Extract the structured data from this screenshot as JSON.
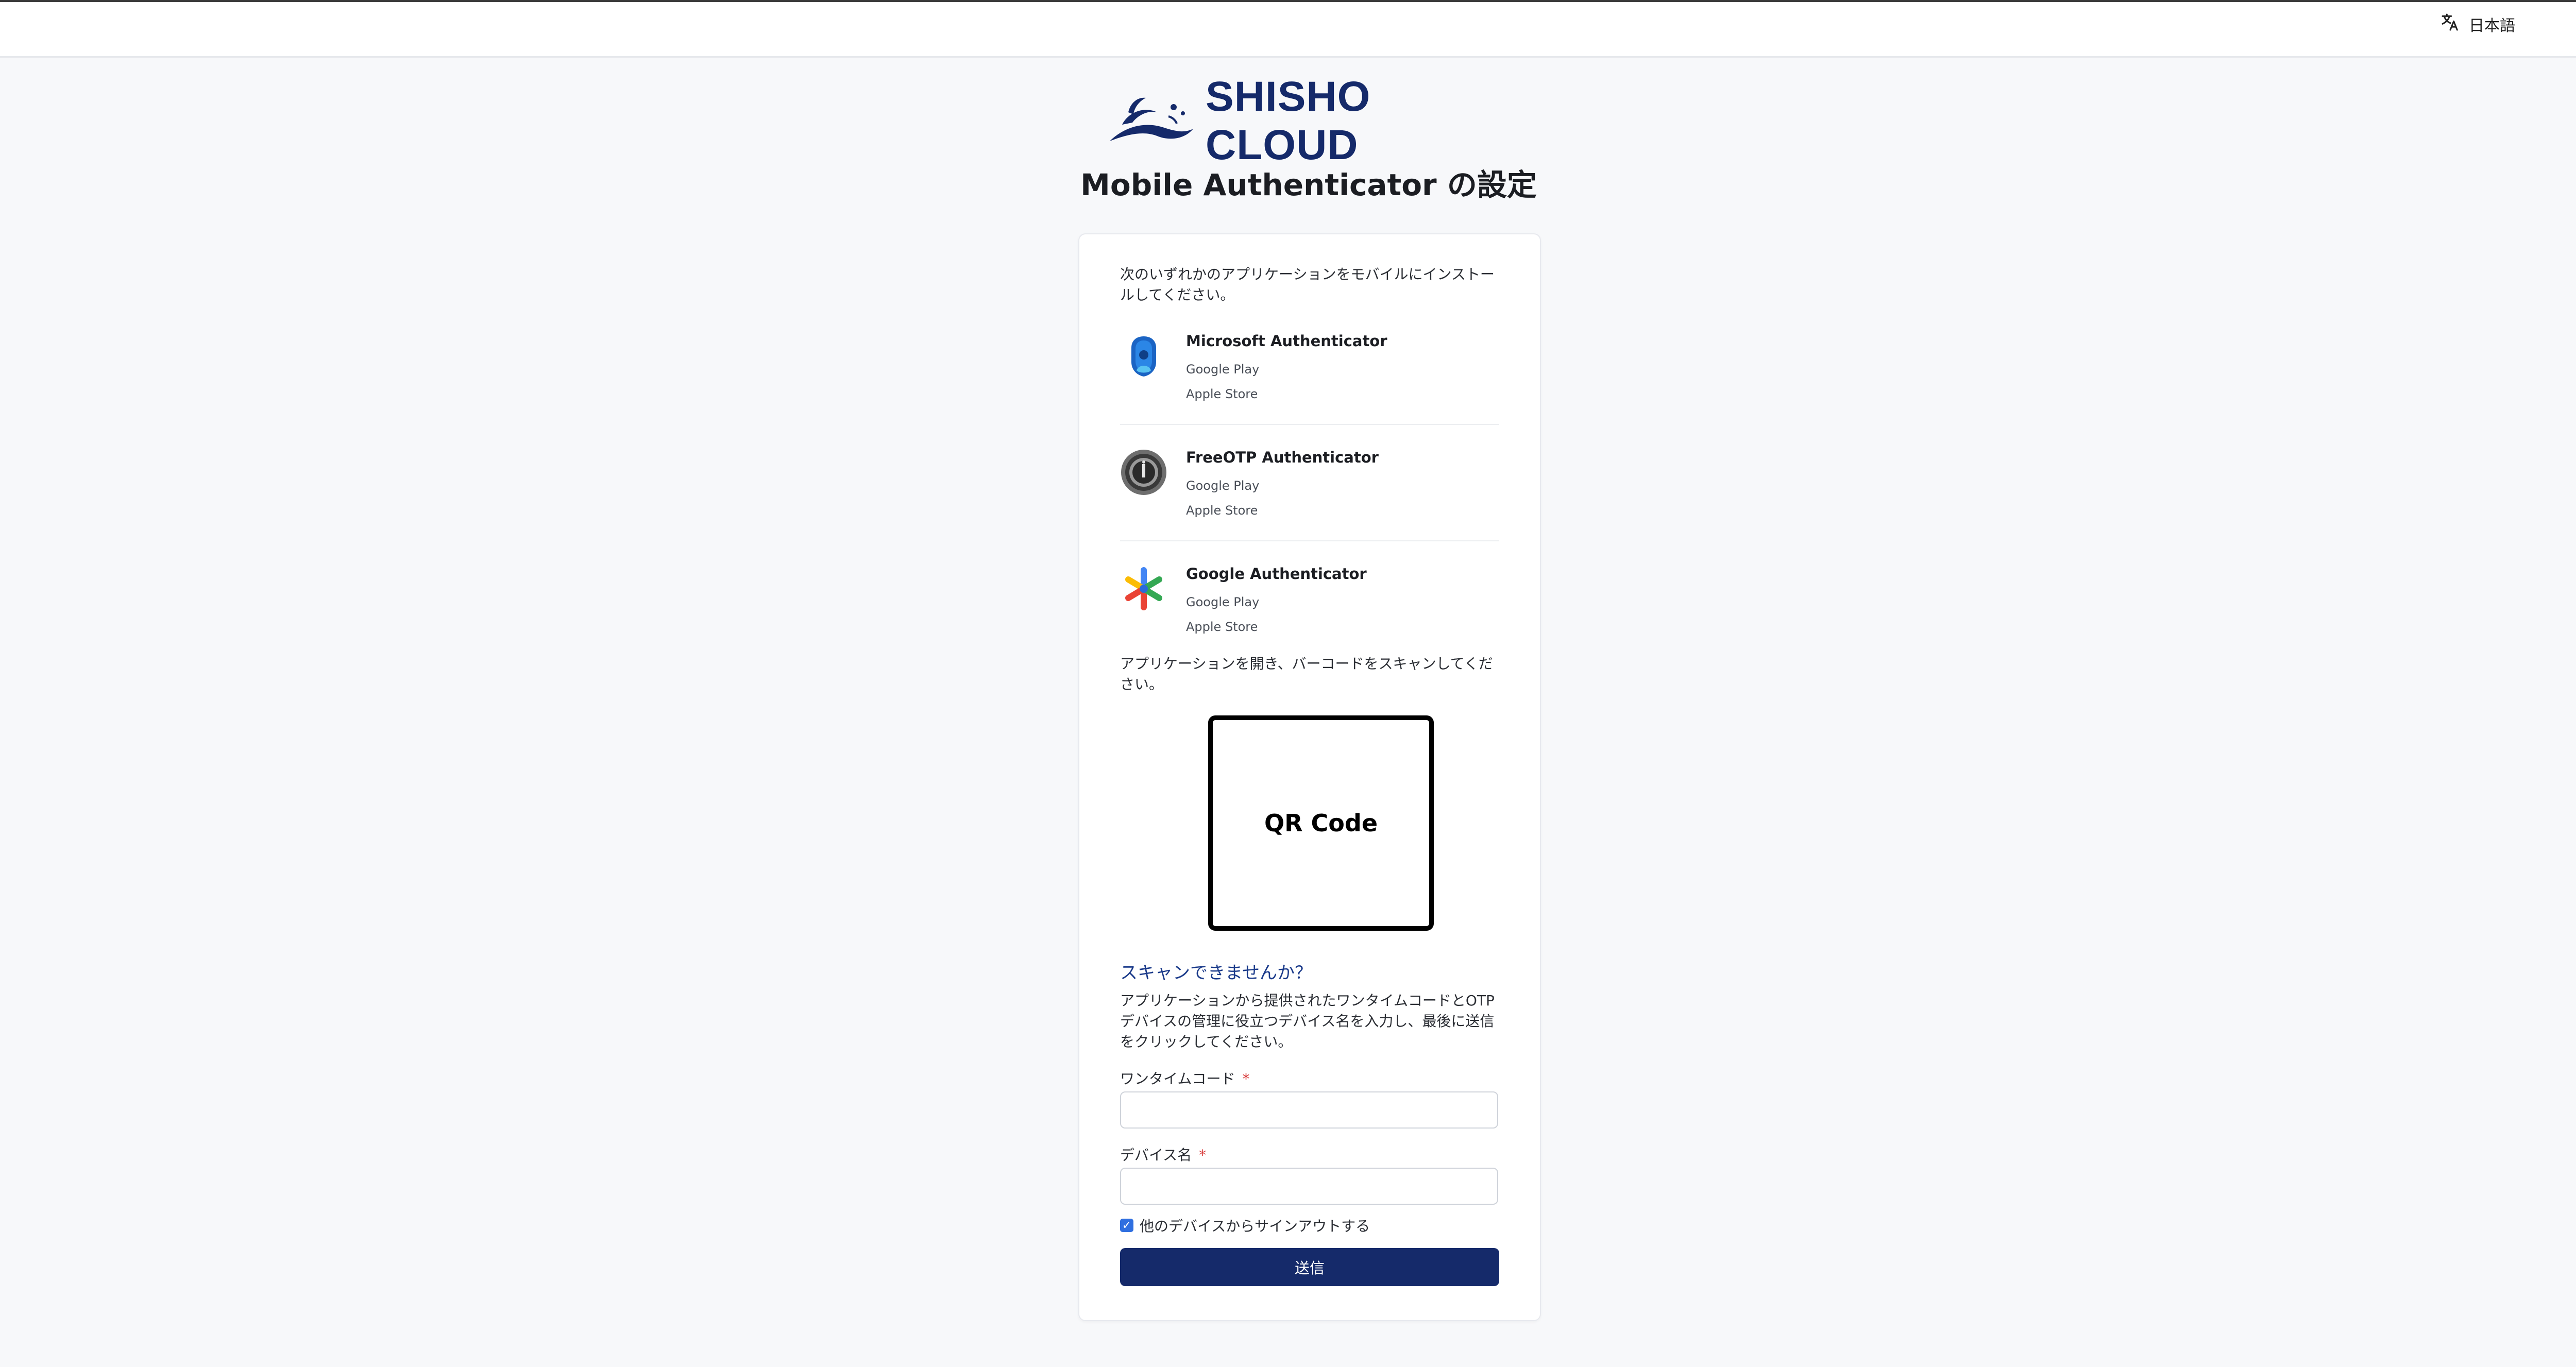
{
  "header": {
    "language": {
      "icon": "translate-icon",
      "label": "日本語",
      "chevron": "chevron-down-icon"
    }
  },
  "brand": {
    "name": "SHISHO CLOUD"
  },
  "page": {
    "title": "Mobile Authenticator の設定"
  },
  "card": {
    "intro": "次のいずれかのアプリケーションをモバイルにインストールしてください。",
    "apps": [
      {
        "name": "Microsoft Authenticator",
        "icon": "microsoft-authenticator-icon",
        "google_play": "Google Play",
        "apple_store": "Apple Store"
      },
      {
        "name": "FreeOTP Authenticator",
        "icon": "freeotp-icon",
        "google_play": "Google Play",
        "apple_store": "Apple Store"
      },
      {
        "name": "Google Authenticator",
        "icon": "google-authenticator-icon",
        "google_play": "Google Play",
        "apple_store": "Apple Store"
      }
    ],
    "scan_text": "アプリケーションを開き、バーコードをスキャンしてください。",
    "qr_label": "QR Code",
    "cant_scan": "スキャンできませんか？",
    "instructions": "アプリケーションから提供されたワンタイムコードとOTPデバイスの管理に役立つデバイス名を入力し、最後に送信をクリックしてください。",
    "form": {
      "otp_label": "ワンタイムコード",
      "otp_value": "",
      "device_label": "デバイス名",
      "device_value": "",
      "required_mark": "*",
      "signout_label": "他のデバイスからサインアウトする",
      "signout_checked": true,
      "submit_label": "送信"
    }
  },
  "colors": {
    "brand_navy": "#152a6a",
    "link_blue": "#1a3a8a",
    "required_red": "#d83a3a",
    "checkbox_blue": "#2f6fe0"
  }
}
